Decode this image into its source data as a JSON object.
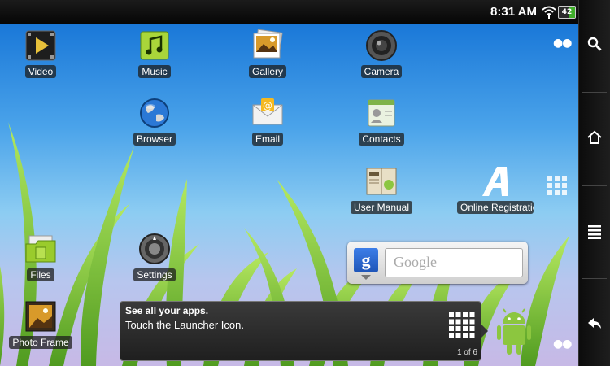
{
  "status": {
    "time": "8:31 AM",
    "battery": "42",
    "battery_level": 0.42
  },
  "apps": {
    "video": "Video",
    "music": "Music",
    "gallery": "Gallery",
    "camera": "Camera",
    "browser": "Browser",
    "email": "Email",
    "contacts": "Contacts",
    "user_manual": "User Manual",
    "online_registration": "Online Registration",
    "files": "Files",
    "settings": "Settings",
    "photo_frame": "Photo Frame"
  },
  "search_widget": {
    "google_letter": "g",
    "placeholder": "Google"
  },
  "tooltip": {
    "title": "See all your apps.",
    "body": "Touch the Launcher Icon.",
    "page": "1 of 6"
  },
  "sidebar": [
    "search-icon",
    "home-icon",
    "menu-icon",
    "back-icon"
  ],
  "colors": {
    "accent_green": "#8cc63f",
    "google_blue": "#2d6ad6"
  }
}
